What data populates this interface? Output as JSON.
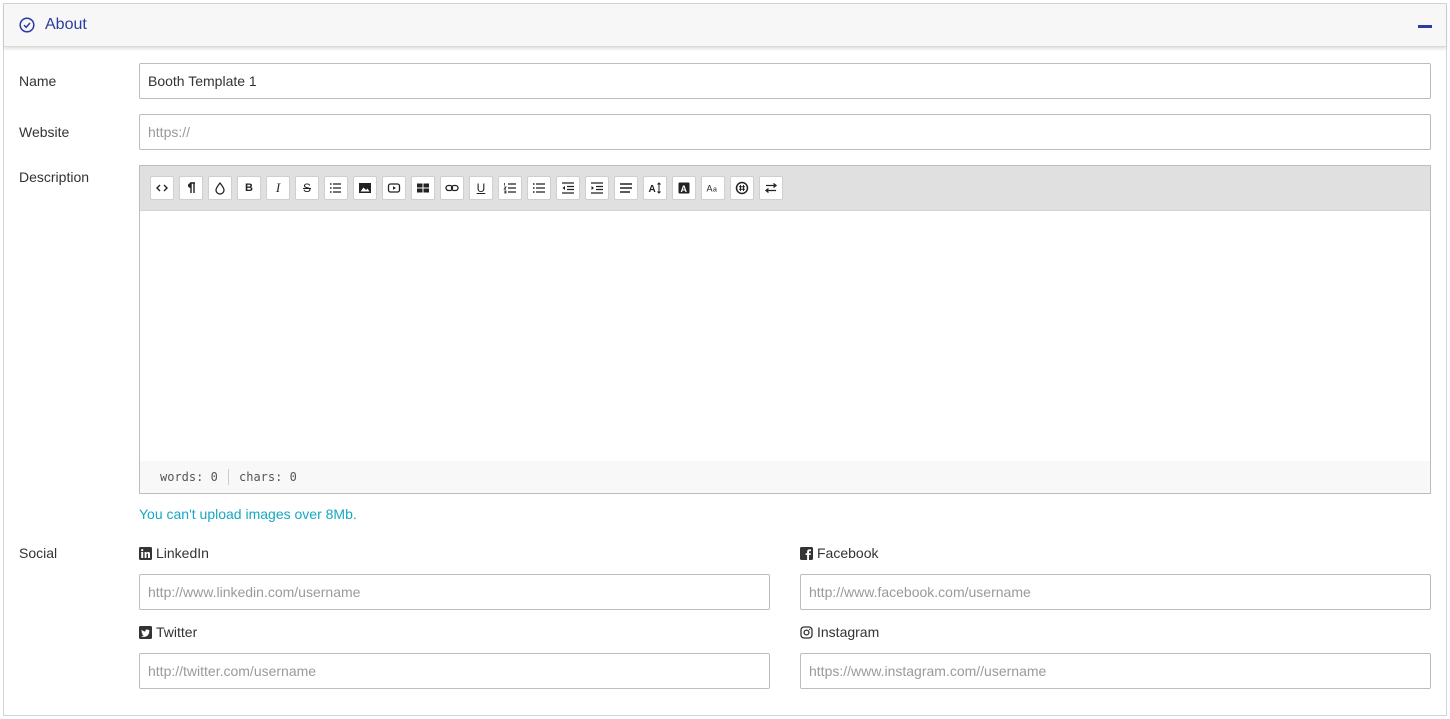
{
  "header": {
    "title": "About",
    "accent": "#2d3ba0"
  },
  "form": {
    "name_label": "Name",
    "name_value": "Booth Template 1",
    "website_label": "Website",
    "website_placeholder": "https://",
    "description_label": "Description",
    "social_label": "Social"
  },
  "editor": {
    "toolbar": [
      {
        "name": "code-view-icon"
      },
      {
        "name": "paragraph-icon"
      },
      {
        "name": "color-drop-icon"
      },
      {
        "name": "bold-icon"
      },
      {
        "name": "italic-icon"
      },
      {
        "name": "strikethrough-icon"
      },
      {
        "name": "list-icon"
      },
      {
        "name": "image-icon"
      },
      {
        "name": "video-icon"
      },
      {
        "name": "table-icon"
      },
      {
        "name": "link-icon"
      },
      {
        "name": "underline-icon"
      },
      {
        "name": "ordered-list-icon"
      },
      {
        "name": "unordered-list-icon"
      },
      {
        "name": "indent-icon"
      },
      {
        "name": "outdent-icon"
      },
      {
        "name": "align-icon"
      },
      {
        "name": "font-size-icon"
      },
      {
        "name": "text-color-icon"
      },
      {
        "name": "font-case-icon"
      },
      {
        "name": "emoji-icon"
      },
      {
        "name": "text-direction-icon"
      }
    ],
    "words": "words: 0",
    "chars": "chars: 0"
  },
  "hint": "You can't upload images over 8Mb.",
  "social": {
    "linkedin": {
      "label": "LinkedIn",
      "placeholder": "http://www.linkedin.com/username"
    },
    "facebook": {
      "label": "Facebook",
      "placeholder": "http://www.facebook.com/username"
    },
    "twitter": {
      "label": "Twitter",
      "placeholder": "http://twitter.com/username"
    },
    "instagram": {
      "label": "Instagram",
      "placeholder": "https://www.instagram.com//username"
    }
  },
  "colors": {
    "hint": "#17a8c2",
    "toolbar_bg": "#e0e0e0"
  }
}
